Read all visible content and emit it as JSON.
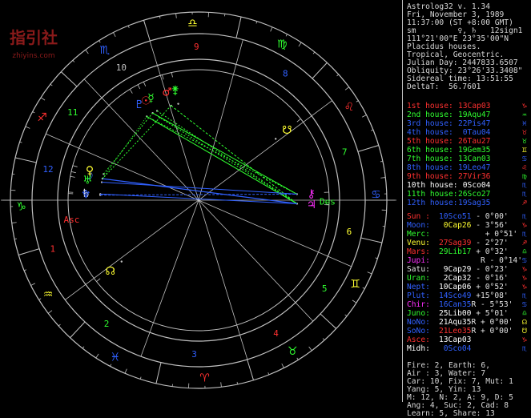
{
  "header": [
    "Astrolog32 v. 1.34",
    "Fri, November 3, 1989",
    "11:37:00 (ST +8:00 GMT)",
    "sm         ♀, ♄   12sign1",
    "111°21'00\"E 23°35'00\"N",
    "Placidus houses.",
    "Tropical, Geocentric.",
    "Julian Day: 2447833.6507",
    "Obliquity: 23°26'33.3408\"",
    "Sidereal time: 13:51:55",
    "DeltaT:  56.7601"
  ],
  "houses": [
    {
      "label": "1st house:",
      "value": "13Cap03",
      "color": "#ff3030",
      "glyph": "♑",
      "gcolor": "#ff3030"
    },
    {
      "label": "2nd house:",
      "value": "19Aqu47",
      "color": "#30ff30",
      "glyph": "♒",
      "gcolor": "#30ff30"
    },
    {
      "label": "3rd house:",
      "value": "22Pis47",
      "color": "#3060ff",
      "glyph": "♓",
      "gcolor": "#3060ff"
    },
    {
      "label": "4th house:",
      "value": " 0Tau04",
      "color": "#3060ff",
      "glyph": "♉",
      "gcolor": "#ff3030"
    },
    {
      "label": "5th house:",
      "value": "26Tau27",
      "color": "#ff3030",
      "glyph": "♉",
      "gcolor": "#30ff30"
    },
    {
      "label": "6th house:",
      "value": "19Gem35",
      "color": "#30ff30",
      "glyph": "♊",
      "gcolor": "#ffff30"
    },
    {
      "label": "7th house:",
      "value": "13Can03",
      "color": "#30ff30",
      "glyph": "♋",
      "gcolor": "#3060ff"
    },
    {
      "label": "8th house:",
      "value": "19Leo47",
      "color": "#3060ff",
      "glyph": "♌",
      "gcolor": "#ff3030"
    },
    {
      "label": "9th house:",
      "value": "27Vir36",
      "color": "#ff3030",
      "glyph": "♍",
      "gcolor": "#30ff30"
    },
    {
      "label": "10th house:",
      "value": " 0Sco04",
      "color": "#ffffff",
      "glyph": "♏",
      "gcolor": "#3060ff"
    },
    {
      "label": "11th house:",
      "value": "26Sco27",
      "color": "#30ff30",
      "glyph": "♏",
      "gcolor": "#3060ff"
    },
    {
      "label": "12th house:",
      "value": "19Sag35",
      "color": "#3060ff",
      "glyph": "♐",
      "gcolor": "#ff3030"
    }
  ],
  "planets": [
    {
      "name": "Sun :",
      "value": "10Sco51",
      "tail": " - 0°00'",
      "ncolor": "#ff3030",
      "vcolor": "#3060ff",
      "glyph": "♏",
      "gcolor": "#3060ff"
    },
    {
      "name": "Moon:",
      "value": " 0Cap26",
      "tail": " - 3°56'",
      "ncolor": "#3060ff",
      "vcolor": "#ffff30",
      "glyph": "♑",
      "gcolor": "#ff3030"
    },
    {
      "name": "Merc:",
      "value": "         ",
      "tail": " + 0°51'",
      "ncolor": "#30ff30",
      "vcolor": "#30ff30",
      "glyph": "♏",
      "gcolor": "#3060ff"
    },
    {
      "name": "Venu:",
      "value": "27Sag39",
      "tail": " - 2°27'",
      "ncolor": "#ffff30",
      "vcolor": "#ff3030",
      "glyph": "♐",
      "gcolor": "#ff3030"
    },
    {
      "name": "Mars:",
      "value": "29Lib17",
      "tail": " + 0°32'",
      "ncolor": "#ff3030",
      "vcolor": "#30ff30",
      "glyph": "♎",
      "gcolor": "#30ff30"
    },
    {
      "name": "Jupi:",
      "value": "         ",
      "tail": "R - 0°14'",
      "ncolor": "#ff30ff",
      "vcolor": "#3060ff",
      "glyph": "♋",
      "gcolor": "#3060ff"
    },
    {
      "name": "Satu:",
      "value": " 9Cap29",
      "tail": " - 0°23'",
      "ncolor": "#e0e0e0",
      "vcolor": "#ffffff",
      "glyph": "♑",
      "gcolor": "#ff3030"
    },
    {
      "name": "Uran:",
      "value": " 2Cap32",
      "tail": " - 0°16'",
      "ncolor": "#30ff30",
      "vcolor": "#ffffff",
      "glyph": "♑",
      "gcolor": "#ff3030"
    },
    {
      "name": "Nept:",
      "value": "10Cap06",
      "tail": " + 0°52'",
      "ncolor": "#3060ff",
      "vcolor": "#ffffff",
      "glyph": "♑",
      "gcolor": "#ff3030"
    },
    {
      "name": "Plut:",
      "value": "14Sco49",
      "tail": " +15°08'",
      "ncolor": "#3060ff",
      "vcolor": "#3060ff",
      "glyph": "♏",
      "gcolor": "#3060ff"
    },
    {
      "name": "Chir:",
      "value": "16Can35",
      "tail": "R - 5°53'",
      "ncolor": "#ff30ff",
      "vcolor": "#3060ff",
      "glyph": "♋",
      "gcolor": "#3060ff"
    },
    {
      "name": "Juno:",
      "value": "25Lib00",
      "tail": " + 5°01'",
      "ncolor": "#30ff30",
      "vcolor": "#ffffff",
      "glyph": "♎",
      "gcolor": "#30ff30"
    },
    {
      "name": "NoNo:",
      "value": "21Aqu35",
      "tail": "R + 0°00'",
      "ncolor": "#3060ff",
      "vcolor": "#ffffff",
      "glyph": "☊",
      "gcolor": "#ffff30"
    },
    {
      "name": "SoNo:",
      "value": "21Leo35",
      "tail": "R + 0°00'",
      "ncolor": "#3060ff",
      "vcolor": "#ff3030",
      "glyph": "☋",
      "gcolor": "#ffff30"
    },
    {
      "name": "Asce:",
      "value": "13Cap03",
      "tail": "",
      "ncolor": "#ff3030",
      "vcolor": "#ffffff",
      "glyph": "♑",
      "gcolor": "#ff3030"
    },
    {
      "name": "Midh:",
      "value": " 0Sco04",
      "tail": "",
      "ncolor": "#ffffff",
      "vcolor": "#3060ff",
      "glyph": "♏",
      "gcolor": "#3060ff"
    }
  ],
  "footer": [
    "Fire: 2, Earth: 6,",
    "Air : 3, Water: 7",
    "Car: 10, Fix: 7, Mut: 1",
    "Yang: 5, Yin: 13",
    "M: 12, N: 2, A: 9, D: 5",
    "Ang: 4, Suc: 2, Cad: 8",
    "Learn: 5, Share: 13"
  ],
  "watermark": {
    "text": "指引社",
    "subtext": "zhiyins.com"
  },
  "wheel": {
    "house_numbers": [
      "1",
      "2",
      "3",
      "4",
      "5",
      "6",
      "7",
      "8",
      "9",
      "10",
      "11",
      "12"
    ],
    "asc_label": "Asc",
    "des_label": "Des",
    "colors": {
      "fire": "#ff3030",
      "earth": "#30ff30",
      "air": "#ffff30",
      "water": "#3060ff",
      "line": "#c0c0c0"
    }
  }
}
